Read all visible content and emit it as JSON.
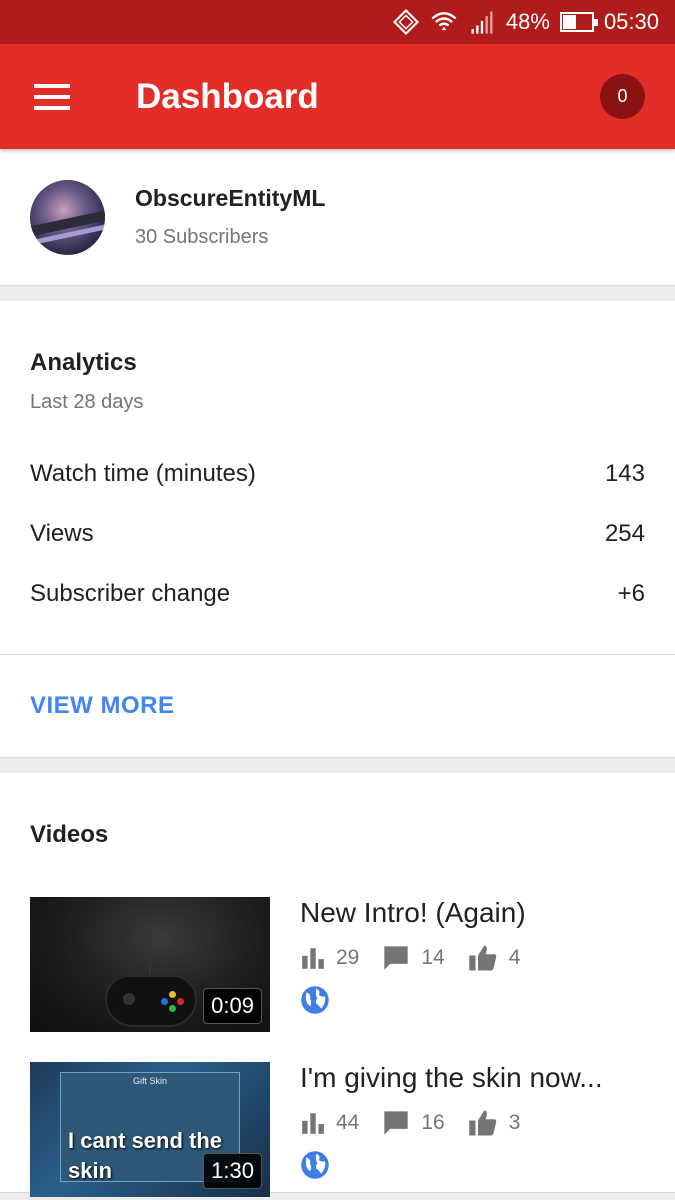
{
  "status_bar": {
    "battery": "48%",
    "battery_level": 0.48,
    "time": "05:30",
    "icons": [
      "rotate-icon",
      "wifi-icon",
      "signal-icon",
      "battery-icon"
    ]
  },
  "app_bar": {
    "title": "Dashboard",
    "notification_count": "0",
    "colors": {
      "bar": "#e52d27",
      "status": "#b01c1c",
      "badge": "#8b1212"
    }
  },
  "channel": {
    "name": "ObscureEntityML",
    "subscribers": "30 Subscribers"
  },
  "analytics": {
    "title": "Analytics",
    "period": "Last 28 days",
    "metrics": [
      {
        "label": "Watch time (minutes)",
        "value": "143"
      },
      {
        "label": "Views",
        "value": "254"
      },
      {
        "label": "Subscriber change",
        "value": "+6"
      }
    ],
    "view_more": "VIEW MORE",
    "link_color": "#4285f4"
  },
  "videos": {
    "title": "Videos",
    "items": [
      {
        "title": "New Intro! (Again)",
        "duration": "0:09",
        "views": "29",
        "comments": "14",
        "likes": "4"
      },
      {
        "title": "I'm giving the skin now...",
        "duration": "1:30",
        "views": "44",
        "comments": "16",
        "likes": "3",
        "thumb_text": "I cant send the skin",
        "dialog_title": "Gift Skin"
      }
    ]
  }
}
